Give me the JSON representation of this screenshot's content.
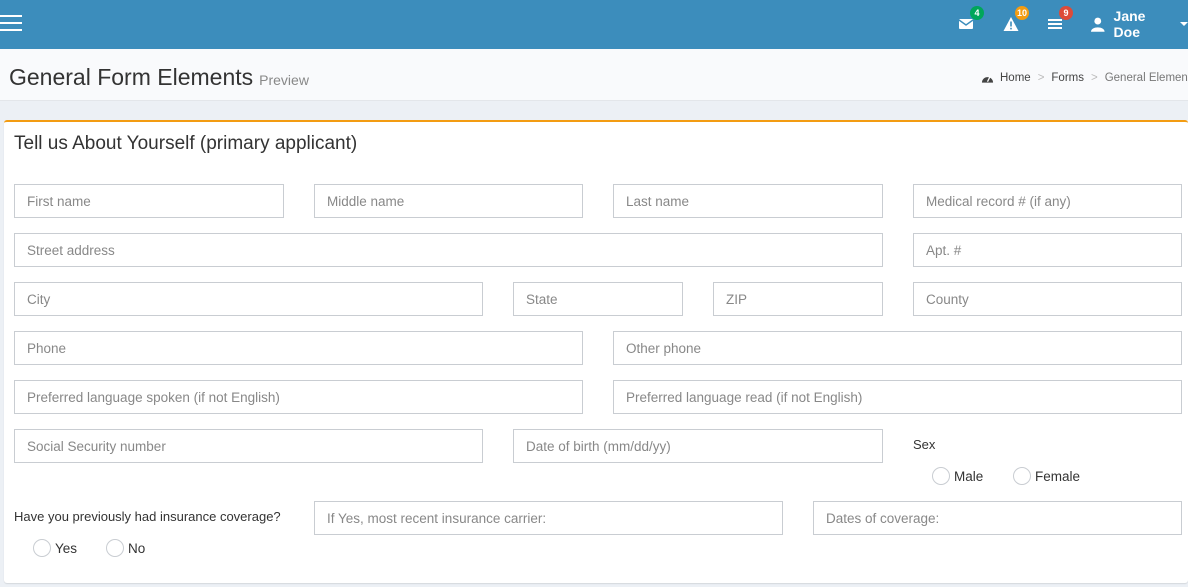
{
  "navbar": {
    "user_name": "Jane Doe",
    "notifications": [
      {
        "icon": "envelope-icon",
        "count": "4",
        "color": "green"
      },
      {
        "icon": "warning-icon",
        "count": "10",
        "color": "orange"
      },
      {
        "icon": "tasks-icon",
        "count": "9",
        "color": "red"
      }
    ]
  },
  "header": {
    "title": "General Form Elements",
    "subtitle": "Preview",
    "breadcrumb": [
      "Home",
      "Forms",
      "General Elements"
    ]
  },
  "form": {
    "title": "Tell us About Yourself (primary applicant)",
    "first_name": "First name",
    "middle_name": "Middle name",
    "last_name": "Last name",
    "medical_record": "Medical record # (if any)",
    "street": "Street address",
    "apt": "Apt. #",
    "city": "City",
    "state": "State",
    "zip": "ZIP",
    "county": "County",
    "phone": "Phone",
    "other_phone": "Other phone",
    "lang_spoken": "Preferred language spoken (if not English)",
    "lang_read": "Preferred language read (if not English)",
    "ssn": "Social Security number",
    "dob": "Date of birth (mm/dd/yy)",
    "sex_label": "Sex",
    "male": "Male",
    "female": "Female",
    "insurance_question": "Have you previously had insurance coverage?",
    "yes": "Yes",
    "no": "No",
    "carrier": "If Yes, most recent insurance carrier:",
    "coverage_dates": "Dates of coverage:"
  },
  "colors": {
    "navbar": "#3c8dbc",
    "box_accent": "#f39c12"
  }
}
